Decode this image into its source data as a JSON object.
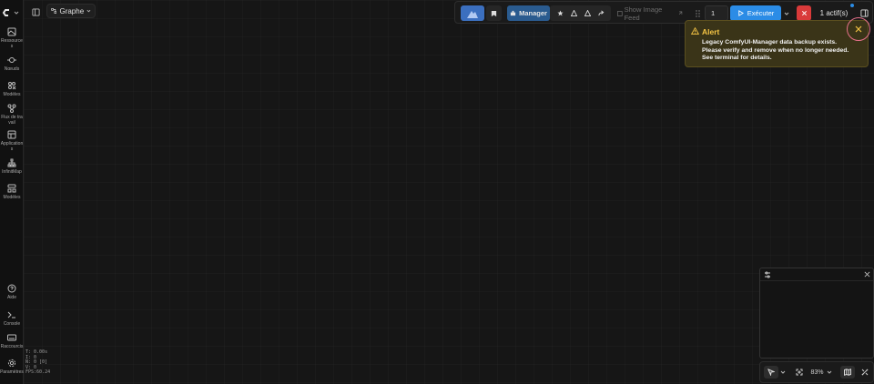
{
  "sidebar": {
    "items": [
      {
        "label": "Ressources",
        "icon": "image-icon"
      },
      {
        "label": "Nœuds",
        "icon": "node-icon"
      },
      {
        "label": "Modèles",
        "icon": "models-icon"
      },
      {
        "label": "Flux de travail",
        "icon": "workflow-icon"
      },
      {
        "label": "Applications",
        "icon": "apps-icon"
      },
      {
        "label": "InfinitMap",
        "icon": "hierarchy-icon"
      },
      {
        "label": "Modèles",
        "icon": "templates-icon"
      }
    ],
    "bottom_items": [
      {
        "label": "Aide",
        "icon": "help-icon"
      },
      {
        "label": "Console",
        "icon": "terminal-icon"
      },
      {
        "label": "Raccourcis",
        "icon": "keyboard-icon"
      },
      {
        "label": "Paramètres",
        "icon": "gear-icon"
      }
    ]
  },
  "header": {
    "graph_tab": "Graphe"
  },
  "toolbar": {
    "manager_label": "Manager",
    "show_image_feed": "Show Image Feed",
    "queue_count": "1",
    "run_label": "Exécuter",
    "active_label": "1 actif(s)",
    "accent": "#2b8ce6",
    "danger": "#d93a3a"
  },
  "alert": {
    "title": "Alert",
    "message": "Legacy ComfyUI-Manager data backup exists. Please verify and remove when no longer needed. See terminal for details.",
    "color": "#f5c444"
  },
  "stats": {
    "t": "T: 0.00s",
    "i": "I: 0",
    "n": "N: 0 [0]",
    "v": "V: 0",
    "fps": "FPS:60.24"
  },
  "controls": {
    "zoom": "83%"
  }
}
